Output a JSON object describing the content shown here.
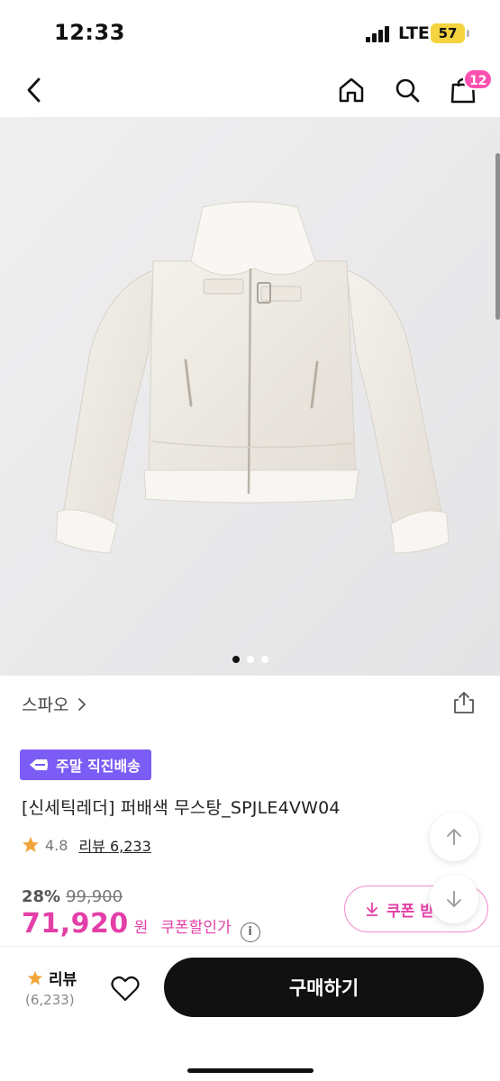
{
  "status_bar": {
    "time": "12:33",
    "network": "LTE",
    "battery": "57"
  },
  "nav": {
    "cart_count": "12"
  },
  "gallery": {
    "total_dots": 3,
    "active_index": 0
  },
  "product": {
    "brand": "스파오",
    "delivery_badge": "주말 직진배송",
    "title": "[신세틱레더] 퍼배색 무스탕_SPJLE4VW04",
    "rating": "4.8",
    "review_link": "리뷰 6,233",
    "discount": "28%",
    "original_price": "99,900",
    "sale_price": "71,920",
    "currency": "원",
    "coupon_price_label": "쿠폰할인가",
    "coupon_button": "쿠폰 받"
  },
  "bottom_bar": {
    "review_label": "리뷰",
    "review_count": "(6,233)",
    "buy_button": "구매하기"
  },
  "colors": {
    "accent": "#e43fa8",
    "badge": "#7b5cf5",
    "star": "#f2a63a"
  }
}
